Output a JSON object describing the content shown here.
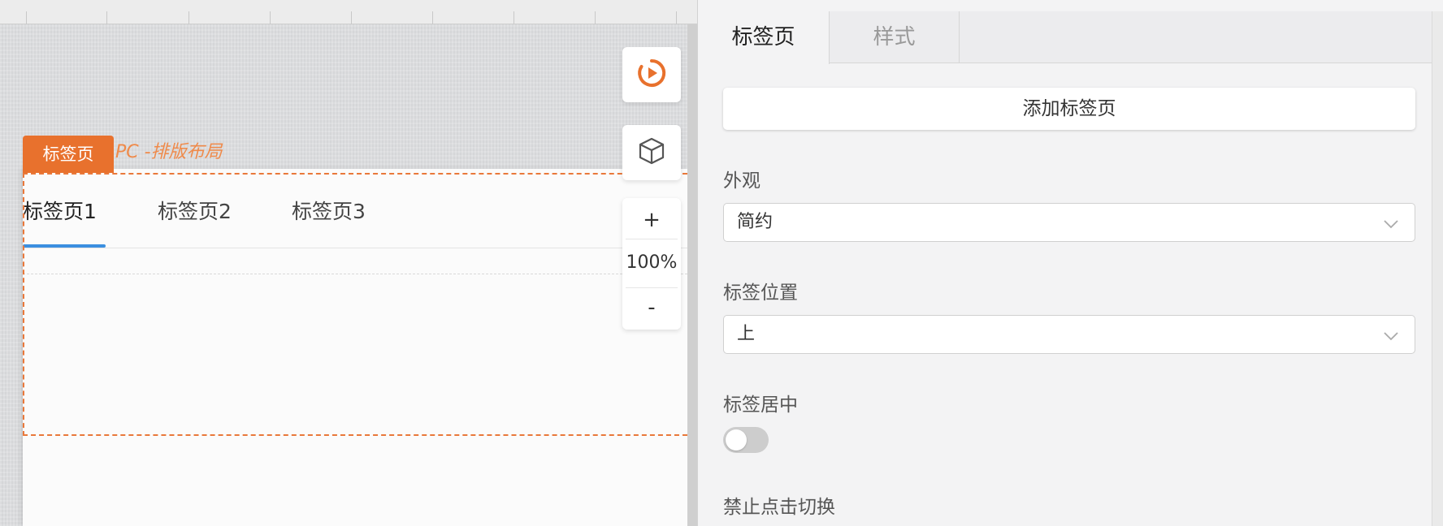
{
  "canvas": {
    "component_badge": "标签页",
    "component_path": "PC -排版布局",
    "tabs": [
      "标签页1",
      "标签页2",
      "标签页3"
    ],
    "active_tab_index": 0,
    "zoom": {
      "plus": "+",
      "level": "100%",
      "minus": "-"
    },
    "icons": {
      "preview": "play-circle-icon",
      "model": "cube-icon"
    }
  },
  "panel": {
    "tabs": [
      "标签页",
      "样式"
    ],
    "active_tab_index": 0,
    "add_tab_button": "添加标签页",
    "appearance": {
      "label": "外观",
      "value": "简约"
    },
    "tab_position": {
      "label": "标签位置",
      "value": "上"
    },
    "tab_centered": {
      "label": "标签居中",
      "on": false
    },
    "disable_click_switch": {
      "label": "禁止点击切换"
    }
  },
  "colors": {
    "accent": "#e8712d",
    "active_underline": "#3b8fe0",
    "toggle_off": "#cdcdcd"
  }
}
